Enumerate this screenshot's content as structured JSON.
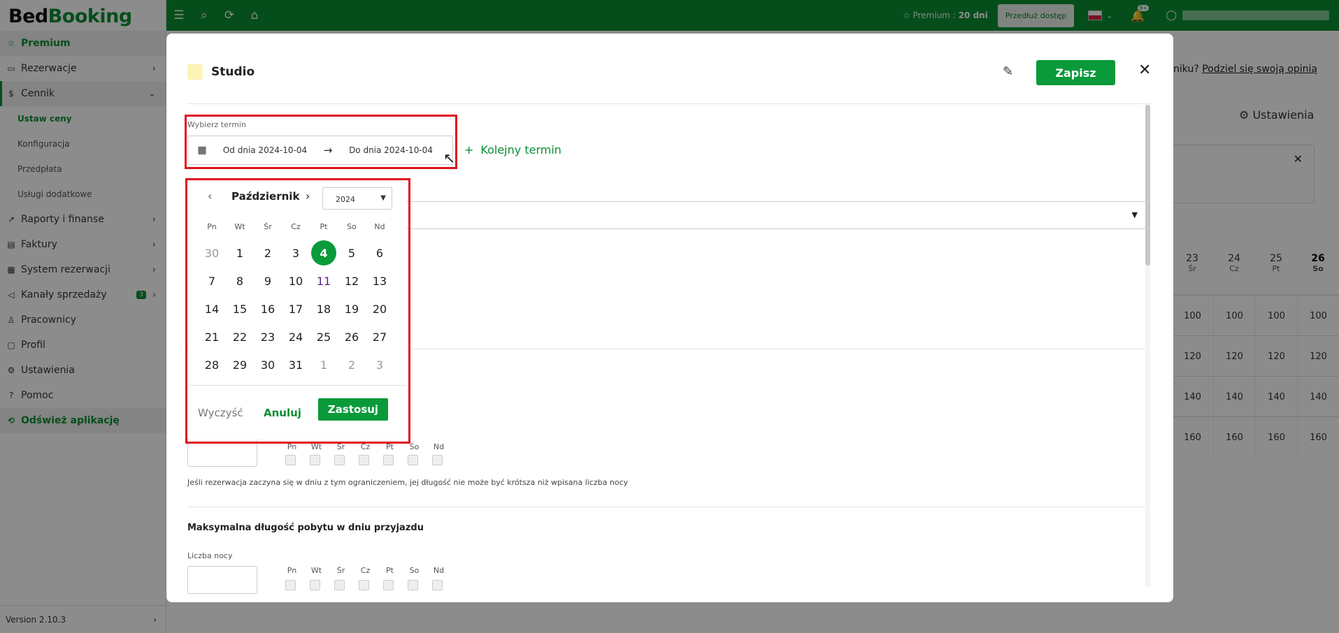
{
  "app": {
    "logo_a": "Bed",
    "logo_b": "Booking"
  },
  "sidebar": {
    "premium": "Premium",
    "rezerwacje": "Rezerwacje",
    "cennik": "Cennik",
    "sub": [
      "Ustaw ceny",
      "Konfiguracja",
      "Przedpłata",
      "Usługi dodatkowe"
    ],
    "raporty": "Raporty i finanse",
    "faktury": "Faktury",
    "system": "System rezerwacji",
    "kanaly": "Kanały sprzedaży",
    "kanaly_badge": "3",
    "pracownicy": "Pracownicy",
    "profil": "Profil",
    "ustawienia": "Ustawienia",
    "pomoc": "Pomoc",
    "odswiez": "Odśwież aplikację",
    "version": "Version 2.10.3"
  },
  "topbar": {
    "premium_prefix": "Premium :",
    "premium_days": "20 dni",
    "extend": "Przedłuż dostęp",
    "notif_badge": "9+"
  },
  "background": {
    "feedback_prefix": "niku?",
    "feedback_link": "Podziel się swoją opinią",
    "settings": "Ustawienia",
    "days": [
      {
        "num": "23",
        "dow": "Śr"
      },
      {
        "num": "24",
        "dow": "Cz"
      },
      {
        "num": "25",
        "dow": "Pt"
      },
      {
        "num": "26",
        "dow": "So"
      }
    ],
    "rows": [
      [
        "100",
        "100",
        "100",
        "100"
      ],
      [
        "120",
        "120",
        "120",
        "120"
      ],
      [
        "140",
        "140",
        "140",
        "140"
      ],
      [
        "160",
        "160",
        "160",
        "160"
      ]
    ]
  },
  "modal": {
    "title": "Studio",
    "save": "Zapisz",
    "term_label": "Wybierz termin",
    "from": "Od dnia 2024-10-04",
    "to": "Do dnia 2024-10-04",
    "add_term": "Kolejny termin",
    "min_hint": "Jeśli rezerwacja zaczyna się w dniu z tym ograniczeniem, jej długość nie może być krótsza niż wpisana liczba nocy",
    "max_title": "Maksymalna długość pobytu w dniu przyjazdu",
    "nights_label": "Liczba nocy",
    "dow": [
      "Pn",
      "Wt",
      "Śr",
      "Cz",
      "Pt",
      "So",
      "Nd"
    ]
  },
  "datepicker": {
    "month": "Październik",
    "year": "2024",
    "dow": [
      "Pn",
      "Wt",
      "Śr",
      "Cz",
      "Pt",
      "So",
      "Nd"
    ],
    "weeks": [
      [
        "30",
        "1",
        "2",
        "3",
        "4",
        "5",
        "6"
      ],
      [
        "7",
        "8",
        "9",
        "10",
        "11",
        "12",
        "13"
      ],
      [
        "14",
        "15",
        "16",
        "17",
        "18",
        "19",
        "20"
      ],
      [
        "21",
        "22",
        "23",
        "24",
        "25",
        "26",
        "27"
      ],
      [
        "28",
        "29",
        "30",
        "31",
        "1",
        "2",
        "3"
      ]
    ],
    "selected": "4",
    "clear": "Wyczyść",
    "cancel": "Anuluj",
    "apply": "Zastosuj"
  }
}
